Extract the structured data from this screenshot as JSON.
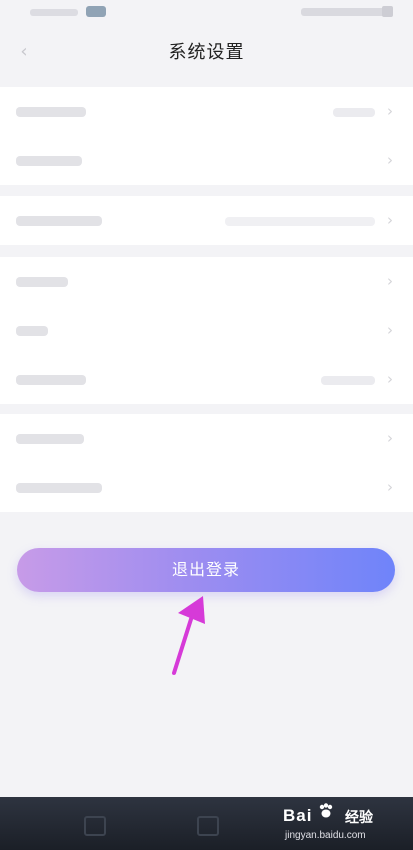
{
  "header": {
    "title": "系统设置"
  },
  "actions": {
    "logout_label": "退出登录"
  },
  "watermark": {
    "brand": "Bai",
    "product": "经验",
    "url": "jingyan.baidu.com"
  },
  "colors": {
    "button_gradient_start": "#c79be8",
    "button_gradient_end": "#6f84fa",
    "annotation_arrow": "#d63ad8",
    "bottom_bar": "#1f232b"
  },
  "icons": {
    "back": "chevron-left-icon",
    "row_more": "chevron-right-icon",
    "nav": "square-icon",
    "brand_mark": "paw-icon"
  }
}
